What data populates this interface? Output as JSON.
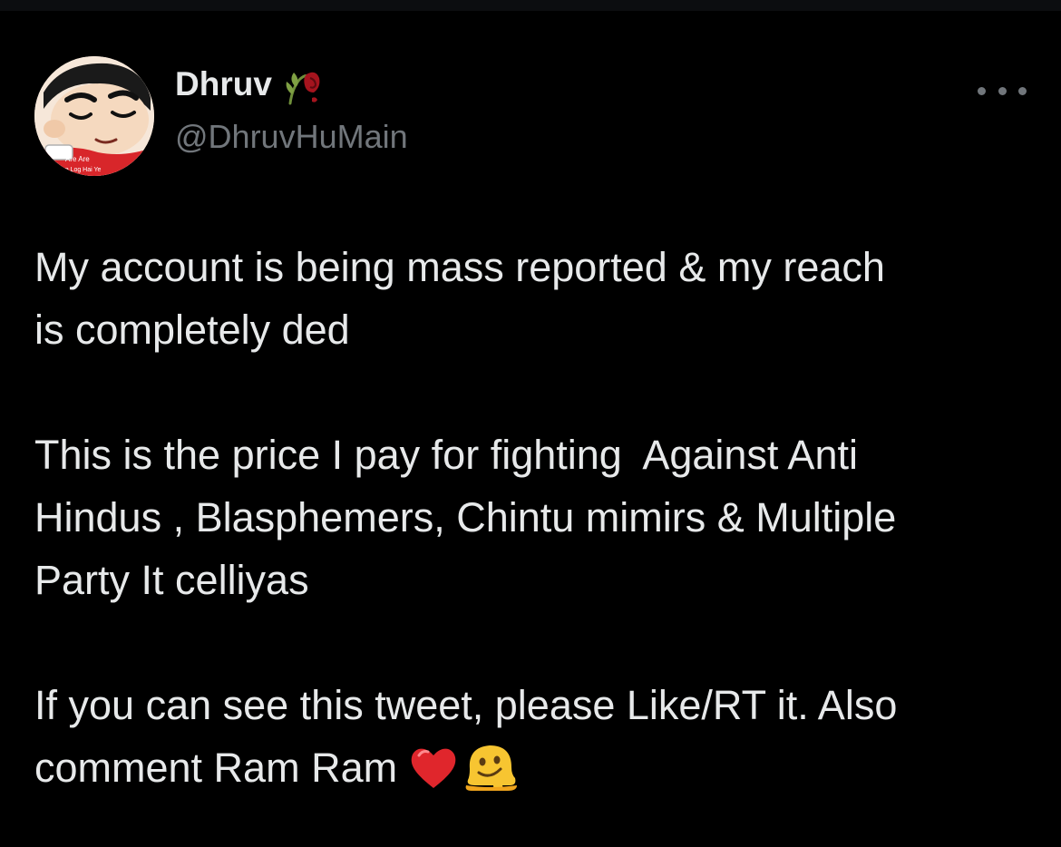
{
  "tweet": {
    "author": {
      "display_name": "Dhruv",
      "name_emoji": "wilted-rose-icon",
      "handle": "@DhruvHuMain",
      "avatar_caption_line1": "Are Are",
      "avatar_caption_line2": "Aise Log Hai Ye"
    },
    "more_menu": "more-options-icon",
    "body": {
      "paragraph1_line1": "My account is being mass reported & my reach",
      "paragraph1_line2": "is completely ded",
      "paragraph2_line1": "This is the price I pay for fighting  Against Anti",
      "paragraph2_line2": "Hindus , Blasphemers, Chintu mimirs & Multiple",
      "paragraph2_line3": "Party It celliyas",
      "paragraph3_line1": "If you can see this tweet, please Like/RT it. Also",
      "paragraph3_line2": "comment Ram Ram"
    },
    "end_emojis": [
      "red-heart-icon",
      "melting-face-icon"
    ]
  },
  "colors": {
    "background": "#000000",
    "primary_text": "#e7e9ea",
    "secondary_text": "#71767b",
    "heart": "#e0262c",
    "emoji_yellow": "#f7c531",
    "avatar_shirt": "#d8262a"
  }
}
